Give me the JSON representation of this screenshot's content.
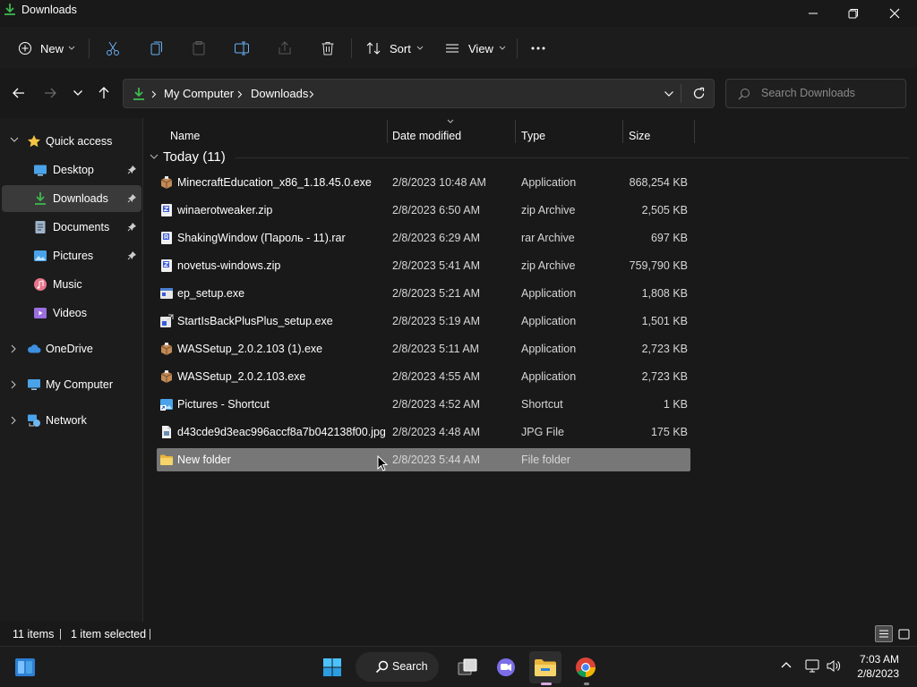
{
  "window": {
    "title": "Downloads"
  },
  "toolbar": {
    "new_label": "New",
    "sort_label": "Sort",
    "view_label": "View"
  },
  "address": {
    "crumbs": [
      "My Computer",
      "Downloads"
    ]
  },
  "search": {
    "placeholder": "Search Downloads"
  },
  "sidebar": {
    "quick_access": "Quick access",
    "items": [
      {
        "label": "Desktop",
        "icon": "desktop-icon",
        "pinned": true
      },
      {
        "label": "Downloads",
        "icon": "download-icon",
        "pinned": true,
        "selected": true
      },
      {
        "label": "Documents",
        "icon": "documents-icon",
        "pinned": true
      },
      {
        "label": "Pictures",
        "icon": "pictures-icon",
        "pinned": true
      },
      {
        "label": "Music",
        "icon": "music-icon"
      },
      {
        "label": "Videos",
        "icon": "videos-icon"
      }
    ],
    "onedrive": "OneDrive",
    "my_computer": "My Computer",
    "network": "Network"
  },
  "columns": {
    "name": "Name",
    "date": "Date modified",
    "type": "Type",
    "size": "Size"
  },
  "group": {
    "title": "Today (11)"
  },
  "files": [
    {
      "name": "MinecraftEducation_x86_1.18.45.0.exe",
      "date": "2/8/2023 10:48 AM",
      "type": "Application",
      "size": "868,254 KB",
      "icon": "installer-icon"
    },
    {
      "name": "winaerotweaker.zip",
      "date": "2/8/2023 6:50 AM",
      "type": "zip Archive",
      "size": "2,505 KB",
      "icon": "zip-icon"
    },
    {
      "name": "ShakingWindow (Пароль - 11).rar",
      "date": "2/8/2023 6:29 AM",
      "type": "rar Archive",
      "size": "697 KB",
      "icon": "rar-icon"
    },
    {
      "name": "novetus-windows.zip",
      "date": "2/8/2023 5:41 AM",
      "type": "zip Archive",
      "size": "759,790 KB",
      "icon": "zip-icon"
    },
    {
      "name": "ep_setup.exe",
      "date": "2/8/2023 5:21 AM",
      "type": "Application",
      "size": "1,808 KB",
      "icon": "exe-icon"
    },
    {
      "name": "StartIsBackPlusPlus_setup.exe",
      "date": "2/8/2023 5:19 AM",
      "type": "Application",
      "size": "1,501 KB",
      "icon": "setup-icon"
    },
    {
      "name": "WASSetup_2.0.2.103 (1).exe",
      "date": "2/8/2023 5:11 AM",
      "type": "Application",
      "size": "2,723 KB",
      "icon": "installer-icon"
    },
    {
      "name": "WASSetup_2.0.2.103.exe",
      "date": "2/8/2023 4:55 AM",
      "type": "Application",
      "size": "2,723 KB",
      "icon": "installer-icon"
    },
    {
      "name": "Pictures - Shortcut",
      "date": "2/8/2023 4:52 AM",
      "type": "Shortcut",
      "size": "1 KB",
      "icon": "shortcut-icon"
    },
    {
      "name": "d43cde9d3eac996accf8a7b042138f00.jpg",
      "date": "2/8/2023 4:48 AM",
      "type": "JPG File",
      "size": "175 KB",
      "icon": "image-file-icon"
    },
    {
      "name": "New folder",
      "date": "2/8/2023 5:44 AM",
      "type": "File folder",
      "size": "",
      "icon": "folder-icon",
      "selected": true
    }
  ],
  "status": {
    "count": "11 items",
    "selected": "1 item selected"
  },
  "taskbar": {
    "search_label": "Search",
    "time": "7:03 AM",
    "date": "2/8/2023"
  },
  "colors": {
    "selection": "#777777",
    "sidebar_selected": "#3a3a3a",
    "accent_green": "#3fb950",
    "folder_yellow": "#f5c542"
  }
}
